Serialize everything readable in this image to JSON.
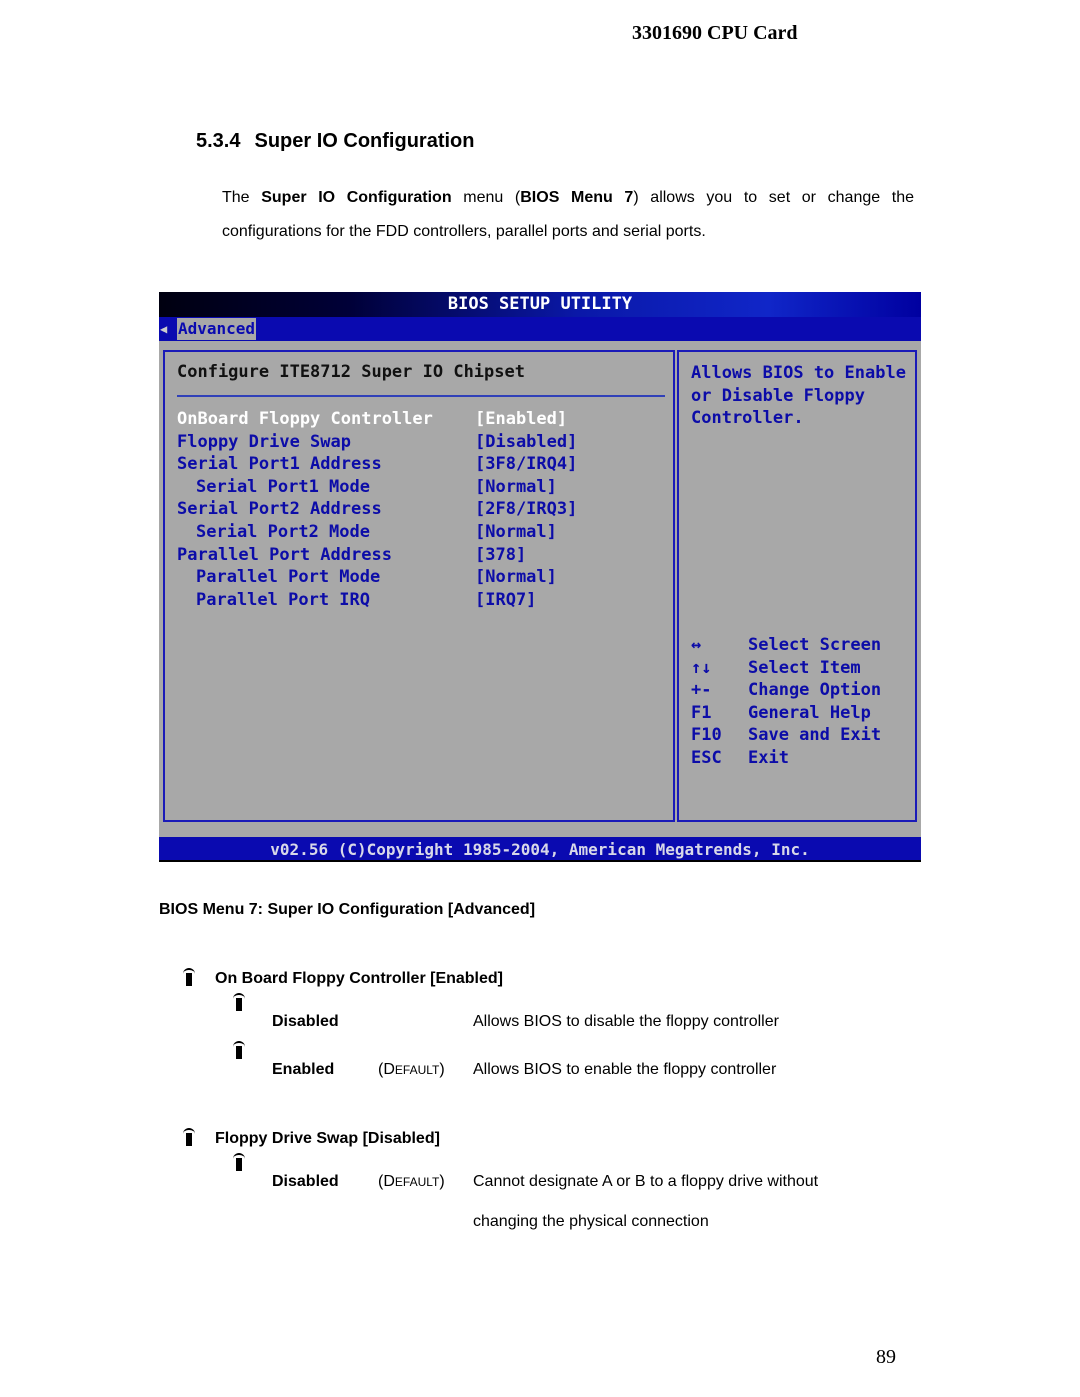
{
  "document": {
    "running_header": "3301690 CPU Card",
    "section": {
      "number": "5.3.4",
      "title": "Super IO Configuration"
    },
    "intro": {
      "p1": "The ",
      "b1": "Super IO Configuration",
      "p2": " menu (",
      "b2": "BIOS Menu 7",
      "p3": ") allows you to set or change the configurations for the FDD controllers, parallel ports and serial ports."
    },
    "caption": "BIOS Menu 7: Super IO Configuration [Advanced]",
    "page_number": "89"
  },
  "bios": {
    "title": "BIOS SETUP UTILITY",
    "tab_arrow_icon": "left-arrow-icon",
    "active_tab": "Advanced",
    "panel_title": "Configure ITE8712 Super IO Chipset",
    "items": [
      {
        "label": "OnBoard Floppy Controller",
        "value": "[Enabled]",
        "selected": true,
        "indent": false
      },
      {
        "label": "Floppy Drive Swap",
        "value": "[Disabled]",
        "selected": false,
        "indent": false
      },
      {
        "label": "Serial Port1 Address",
        "value": "[3F8/IRQ4]",
        "selected": false,
        "indent": false
      },
      {
        "label": "Serial Port1 Mode",
        "value": "[Normal]",
        "selected": false,
        "indent": true
      },
      {
        "label": "Serial Port2 Address",
        "value": "[2F8/IRQ3]",
        "selected": false,
        "indent": false
      },
      {
        "label": "Serial Port2 Mode",
        "value": "[Normal]",
        "selected": false,
        "indent": true
      },
      {
        "label": "Parallel Port Address",
        "value": "[378]",
        "selected": false,
        "indent": false
      },
      {
        "label": "Parallel Port Mode",
        "value": "[Normal]",
        "selected": false,
        "indent": true
      },
      {
        "label": "Parallel Port IRQ",
        "value": "[IRQ7]",
        "selected": false,
        "indent": true
      }
    ],
    "help_lines": [
      "Allows BIOS to Enable",
      "or Disable Floppy",
      "Controller."
    ],
    "keys": [
      {
        "key": "↔",
        "desc": "Select Screen"
      },
      {
        "key": "↑↓",
        "desc": "Select Item"
      },
      {
        "key": "+-",
        "desc": "Change Option"
      },
      {
        "key": "F1",
        "desc": "General Help"
      },
      {
        "key": "F10",
        "desc": "Save and Exit"
      },
      {
        "key": "ESC",
        "desc": "Exit"
      }
    ],
    "footer": "v02.56 (C)Copyright 1985-2004, American Megatrends, Inc."
  },
  "options": [
    {
      "heading": "On Board Floppy Controller [Enabled]",
      "choices": [
        {
          "name": "Disabled",
          "default": "",
          "desc": "Allows BIOS to disable the floppy controller"
        },
        {
          "name": "Enabled",
          "default_open": "(D",
          "default_sc": "EFAULT",
          "default_close": ")",
          "desc": "Allows BIOS to enable the floppy controller"
        }
      ]
    },
    {
      "heading": "Floppy Drive Swap [Disabled]",
      "choices": [
        {
          "name": "Disabled",
          "default_open": "(D",
          "default_sc": "EFAULT",
          "default_close": ")",
          "desc_line1": "Cannot designate A or B to a floppy drive without",
          "desc_line2": "changing the physical connection"
        }
      ]
    }
  ]
}
